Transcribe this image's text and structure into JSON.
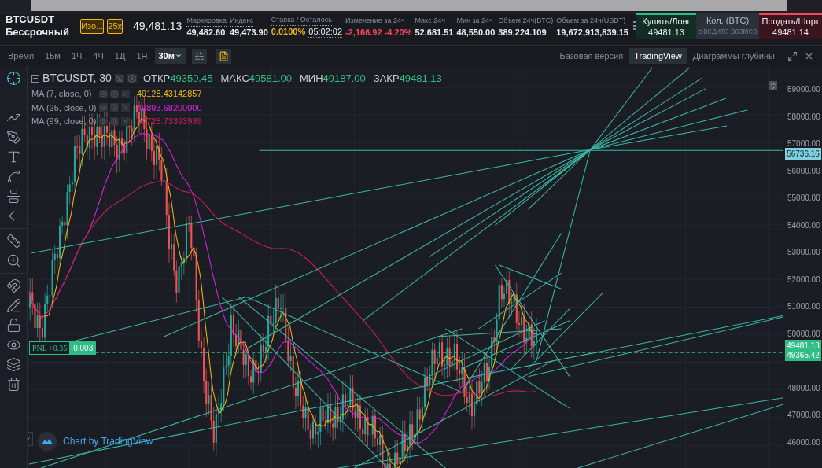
{
  "market": {
    "symbol": "BTCUSDT",
    "contract": "Бессрочный",
    "margin_mode": "Изо...",
    "leverage": "25x",
    "last_price": "49,481.13"
  },
  "stats": [
    {
      "label": "Маркировка",
      "value": "49,482.60",
      "color": "#eaecef",
      "dotted": true
    },
    {
      "label": "Индекс",
      "value": "49,473.90",
      "color": "#eaecef",
      "dotted": true
    },
    {
      "label": "Ставка / Осталось",
      "value": "0.0100%",
      "value2": "05:02:02",
      "color": "#f0b90b",
      "dotted": true
    },
    {
      "label": "Изменение за 24ч",
      "value": "-2,166.92 -4.20%",
      "color": "#f6465d",
      "dotted": false
    },
    {
      "label": "Макс 24ч",
      "value": "52,681.51",
      "color": "#eaecef",
      "dotted": false
    },
    {
      "label": "Мин за 24ч",
      "value": "48,550.00",
      "color": "#eaecef",
      "dotted": false
    },
    {
      "label": "Объем 24ч(BTC)",
      "value": "389,224.109",
      "color": "#eaecef",
      "dotted": false
    },
    {
      "label": "Объем за 24ч(USDT)",
      "value": "19,672,913,839.15",
      "color": "#eaecef",
      "dotted": false
    }
  ],
  "order": {
    "buy": {
      "label": "Купить/Лонг",
      "price": "49481.13"
    },
    "quantity": {
      "label": "Кол. (BTC)",
      "placeholder": "Введите размер"
    },
    "sell": {
      "label": "Продать/Шорт",
      "price": "49481.14"
    }
  },
  "toolbar": {
    "time_label": "Время",
    "intervals": [
      {
        "label": "15м",
        "selected": false
      },
      {
        "label": "1Ч",
        "selected": false
      },
      {
        "label": "4Ч",
        "selected": false
      },
      {
        "label": "1Д",
        "selected": false
      },
      {
        "label": "1Н",
        "selected": false
      },
      {
        "label": "30м",
        "selected": true
      }
    ],
    "views": [
      {
        "label": "Базовая версия",
        "selected": false
      },
      {
        "label": "TradingView",
        "selected": true
      },
      {
        "label": "Диаграммы глубины",
        "selected": false
      }
    ]
  },
  "legend": {
    "title": "BTCUSDT, 30",
    "ohlc": [
      {
        "label": "ОТКР",
        "value": "49350.45"
      },
      {
        "label": "МАКС",
        "value": "49581.00"
      },
      {
        "label": "МИН",
        "value": "49187.00"
      },
      {
        "label": "ЗАКР",
        "value": "49481.13"
      }
    ],
    "ma": [
      {
        "label": "MA (7, close, 0)",
        "value": "49128.43142857",
        "color": "#f0b90b"
      },
      {
        "label": "MA (25, close, 0)",
        "value": "49893.68200000",
        "color": "#e020e0"
      },
      {
        "label": "MA (99, close, 0)",
        "value": "49728.73393939",
        "color": "#d0205a"
      }
    ]
  },
  "price_axis": [
    "59000.00",
    "58000.00",
    "57000.00",
    "56000.00",
    "55000.00",
    "54000.00",
    "53000.00",
    "52000.00",
    "51000.00",
    "50000.00",
    "48000.00",
    "47000.00",
    "46000.00"
  ],
  "price_tags": [
    {
      "value": "56736.16",
      "kind": "drawing"
    },
    {
      "value": "49481.13",
      "kind": "last"
    },
    {
      "value": "49365.42",
      "kind": "entry"
    }
  ],
  "position": {
    "pnl": "PNL +0.35",
    "size": "0.003"
  },
  "attribution": "Chart by TradingView"
}
